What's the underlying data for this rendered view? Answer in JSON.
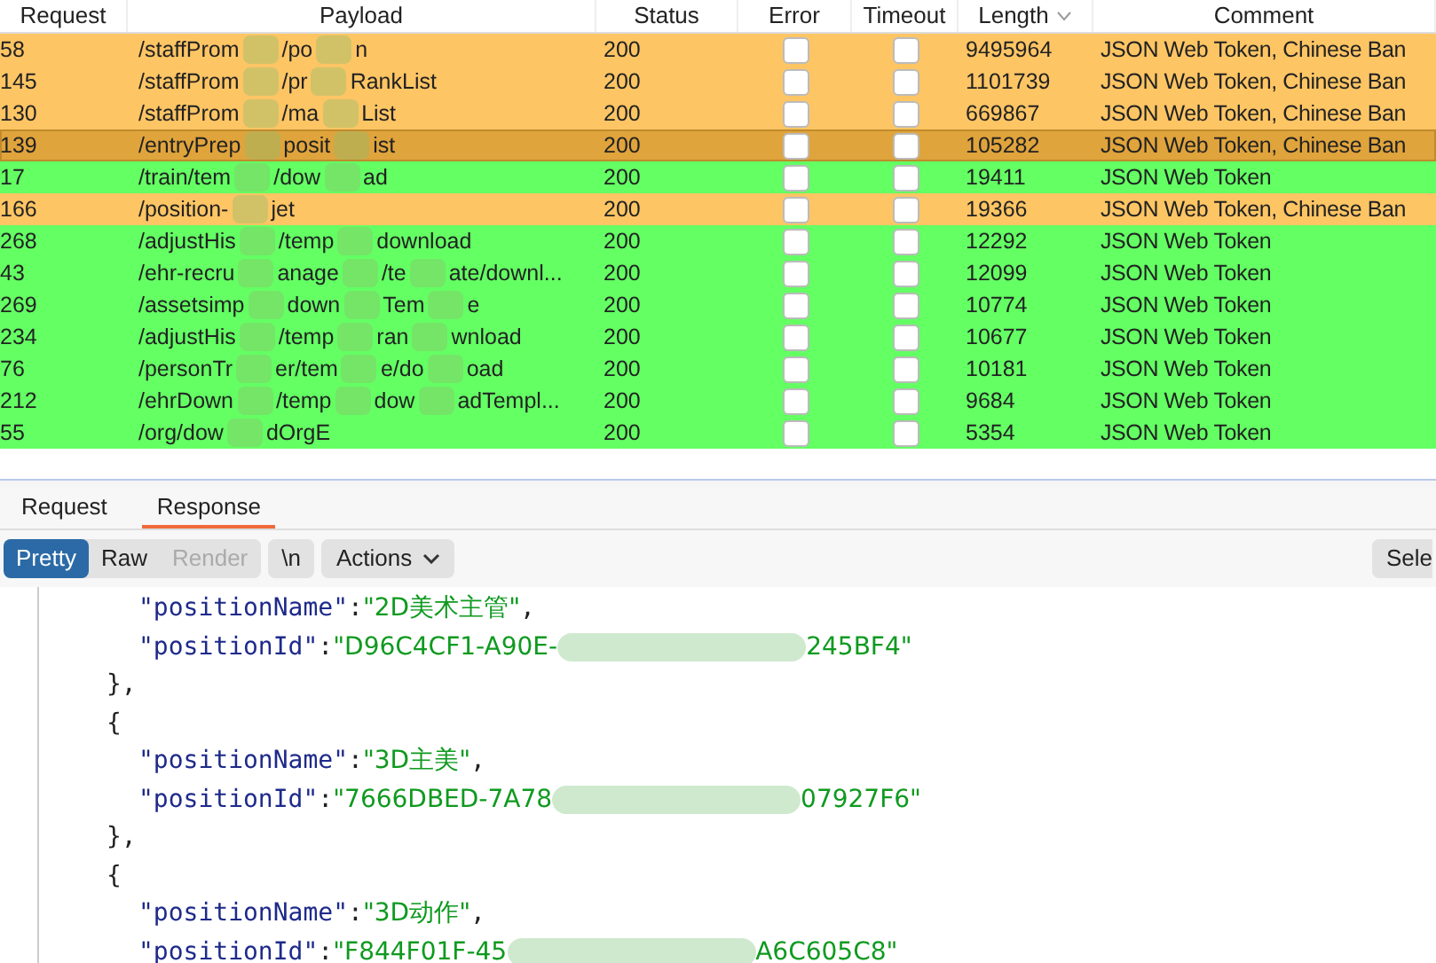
{
  "table": {
    "columns": [
      "Request",
      "Payload",
      "Status",
      "Error",
      "Timeout",
      "Length",
      "Comment"
    ],
    "rows": [
      {
        "request": "58",
        "payload": [
          "/staffProm",
          "/po",
          "n"
        ],
        "status": "200",
        "error": false,
        "timeout": false,
        "length": "9495964",
        "comment": "JSON Web Token, Chinese Ban",
        "color": "#fec564",
        "selected": false
      },
      {
        "request": "145",
        "payload": [
          "/staffProm",
          "/pr",
          "RankList"
        ],
        "status": "200",
        "error": false,
        "timeout": false,
        "length": "1101739",
        "comment": "JSON Web Token, Chinese Ban",
        "color": "#fec564",
        "selected": false
      },
      {
        "request": "130",
        "payload": [
          "/staffProm",
          "/ma",
          "List"
        ],
        "status": "200",
        "error": false,
        "timeout": false,
        "length": "669867",
        "comment": "JSON Web Token, Chinese Ban",
        "color": "#fec564",
        "selected": false
      },
      {
        "request": "139",
        "payload": [
          "/entryPrep",
          "posit",
          "ist"
        ],
        "status": "200",
        "error": false,
        "timeout": false,
        "length": "105282",
        "comment": "JSON Web Token, Chinese Ban",
        "color": "#e0a43c",
        "selected": true
      },
      {
        "request": "17",
        "payload": [
          "/train/tem",
          "/dow",
          "ad"
        ],
        "status": "200",
        "error": false,
        "timeout": false,
        "length": "19411",
        "comment": "JSON Web Token",
        "color": "#63ff63",
        "selected": false
      },
      {
        "request": "166",
        "payload": [
          "/position-",
          "jet"
        ],
        "status": "200",
        "error": false,
        "timeout": false,
        "length": "19366",
        "comment": "JSON Web Token, Chinese Ban",
        "color": "#fec564",
        "selected": false
      },
      {
        "request": "268",
        "payload": [
          "/adjustHis",
          "/temp",
          "download"
        ],
        "status": "200",
        "error": false,
        "timeout": false,
        "length": "12292",
        "comment": "JSON Web Token",
        "color": "#63ff63",
        "selected": false
      },
      {
        "request": "43",
        "payload": [
          "/ehr-recru",
          "anage",
          "/te",
          "ate/downl..."
        ],
        "status": "200",
        "error": false,
        "timeout": false,
        "length": "12099",
        "comment": "JSON Web Token",
        "color": "#63ff63",
        "selected": false
      },
      {
        "request": "269",
        "payload": [
          "/assetsimp",
          "down",
          "Tem",
          "e"
        ],
        "status": "200",
        "error": false,
        "timeout": false,
        "length": "10774",
        "comment": "JSON Web Token",
        "color": "#63ff63",
        "selected": false
      },
      {
        "request": "234",
        "payload": [
          "/adjustHis",
          "/temp",
          "ran",
          "wnload"
        ],
        "status": "200",
        "error": false,
        "timeout": false,
        "length": "10677",
        "comment": "JSON Web Token",
        "color": "#63ff63",
        "selected": false
      },
      {
        "request": "76",
        "payload": [
          "/personTr",
          "er/tem",
          "e/do",
          "oad"
        ],
        "status": "200",
        "error": false,
        "timeout": false,
        "length": "10181",
        "comment": "JSON Web Token",
        "color": "#63ff63",
        "selected": false
      },
      {
        "request": "212",
        "payload": [
          "/ehrDown",
          "/temp",
          "dow",
          "adTempl..."
        ],
        "status": "200",
        "error": false,
        "timeout": false,
        "length": "9684",
        "comment": "JSON Web Token",
        "color": "#63ff63",
        "selected": false
      },
      {
        "request": "55",
        "payload": [
          "/org/dow",
          "dOrgE"
        ],
        "status": "200",
        "error": false,
        "timeout": false,
        "length": "5354",
        "comment": "JSON Web Token",
        "color": "#63ff63",
        "selected": false
      }
    ]
  },
  "tabs": [
    {
      "label": "Request",
      "selected": false
    },
    {
      "label": "Response",
      "selected": true
    }
  ],
  "view_buttons": [
    {
      "label": "Pretty",
      "selected": true,
      "disabled": false
    },
    {
      "label": "Raw",
      "selected": false,
      "disabled": false
    },
    {
      "label": "Render",
      "selected": false,
      "disabled": true
    }
  ],
  "newline_button": "\\n",
  "actions_button": "Actions",
  "select_button": "Sele",
  "code": [
    {
      "kind": "field",
      "key": "\"positionName\"",
      "sep": ":",
      "value": [
        "\"2D美术主管\""
      ],
      "end": ","
    },
    {
      "kind": "field",
      "key": "\"positionId\"",
      "sep": ":",
      "value": [
        "\"D96C4CF1-A90E-",
        "245BF4\""
      ]
    },
    {
      "kind": "brace",
      "text": "},"
    },
    {
      "kind": "brace",
      "text": "{"
    },
    {
      "kind": "field",
      "key": "\"positionName\"",
      "sep": ":",
      "value": [
        "\"3D主美\""
      ],
      "end": ","
    },
    {
      "kind": "field",
      "key": "\"positionId\"",
      "sep": ":",
      "value": [
        "\"7666DBED-7A78",
        "07927F6\""
      ]
    },
    {
      "kind": "brace",
      "text": "},"
    },
    {
      "kind": "brace",
      "text": "{"
    },
    {
      "kind": "field",
      "key": "\"positionName\"",
      "sep": ":",
      "value": [
        "\"3D动作\""
      ],
      "end": ","
    },
    {
      "kind": "field",
      "key": "\"positionId\"",
      "sep": ":",
      "value": [
        "\"F844F01F-45",
        "A6C605C8\""
      ]
    }
  ]
}
